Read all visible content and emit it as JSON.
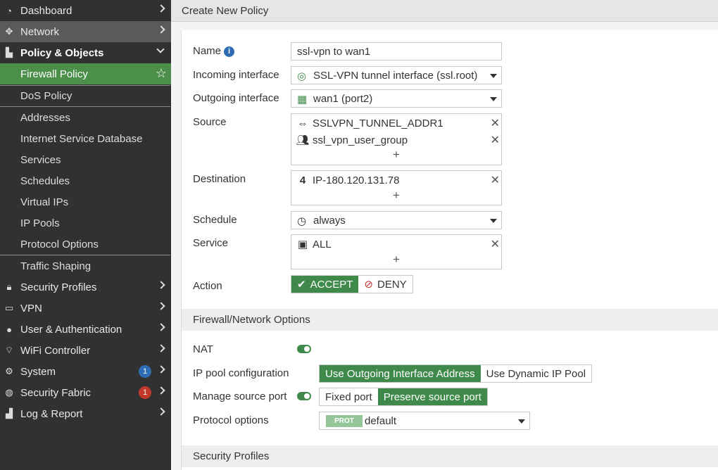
{
  "sidebar": {
    "items": [
      {
        "label": "Dashboard",
        "icon": "dashboard-icon"
      },
      {
        "label": "Network",
        "icon": "network-icon"
      },
      {
        "label": "Policy & Objects",
        "icon": "policy-icon"
      },
      {
        "label": "Security Profiles",
        "icon": "lock-icon"
      },
      {
        "label": "VPN",
        "icon": "laptop-icon"
      },
      {
        "label": "User & Authentication",
        "icon": "user-icon"
      },
      {
        "label": "WiFi Controller",
        "icon": "wifi-icon"
      },
      {
        "label": "System",
        "icon": "gear-icon",
        "badge": "1",
        "badge_color": "#2e6db4"
      },
      {
        "label": "Security Fabric",
        "icon": "fabric-icon",
        "badge": "1",
        "badge_color": "#c0392b"
      },
      {
        "label": "Log & Report",
        "icon": "chart-icon"
      }
    ],
    "sub_items": [
      "Firewall Policy",
      "DoS Policy",
      "Addresses",
      "Internet Service Database",
      "Services",
      "Schedules",
      "Virtual IPs",
      "IP Pools",
      "Protocol Options",
      "Traffic Shaping"
    ]
  },
  "header": {
    "title": "Create New Policy"
  },
  "form": {
    "name_label": "Name",
    "name_value": "ssl-vpn to wan1",
    "incoming_label": "Incoming interface",
    "incoming_value": "SSL-VPN tunnel interface (ssl.root)",
    "outgoing_label": "Outgoing interface",
    "outgoing_value": "wan1 (port2)",
    "source_label": "Source",
    "source_items": [
      "SSLVPN_TUNNEL_ADDR1",
      "ssl_vpn_user_group"
    ],
    "destination_label": "Destination",
    "destination_items": [
      "IP-180.120.131.78"
    ],
    "schedule_label": "Schedule",
    "schedule_value": "always",
    "service_label": "Service",
    "service_items": [
      "ALL"
    ],
    "action_label": "Action",
    "accept_label": "ACCEPT",
    "deny_label": "DENY",
    "plus": "+",
    "remove": "✕"
  },
  "fw_options": {
    "section_title": "Firewall/Network Options",
    "nat_label": "NAT",
    "ip_pool_label": "IP pool configuration",
    "ip_pool_opt1": "Use Outgoing Interface Address",
    "ip_pool_opt2": "Use Dynamic IP Pool",
    "source_port_label": "Manage source port",
    "fixed_port": "Fixed port",
    "preserve_port": "Preserve source port",
    "protocol_label": "Protocol options",
    "protocol_tag": "PROT",
    "protocol_value": "default"
  },
  "security_profiles": {
    "section_title": "Security Profiles"
  },
  "colors": {
    "accent": "#3f8a4a",
    "sidebar_bg": "#313131",
    "active_bg": "#4b8f4b"
  }
}
